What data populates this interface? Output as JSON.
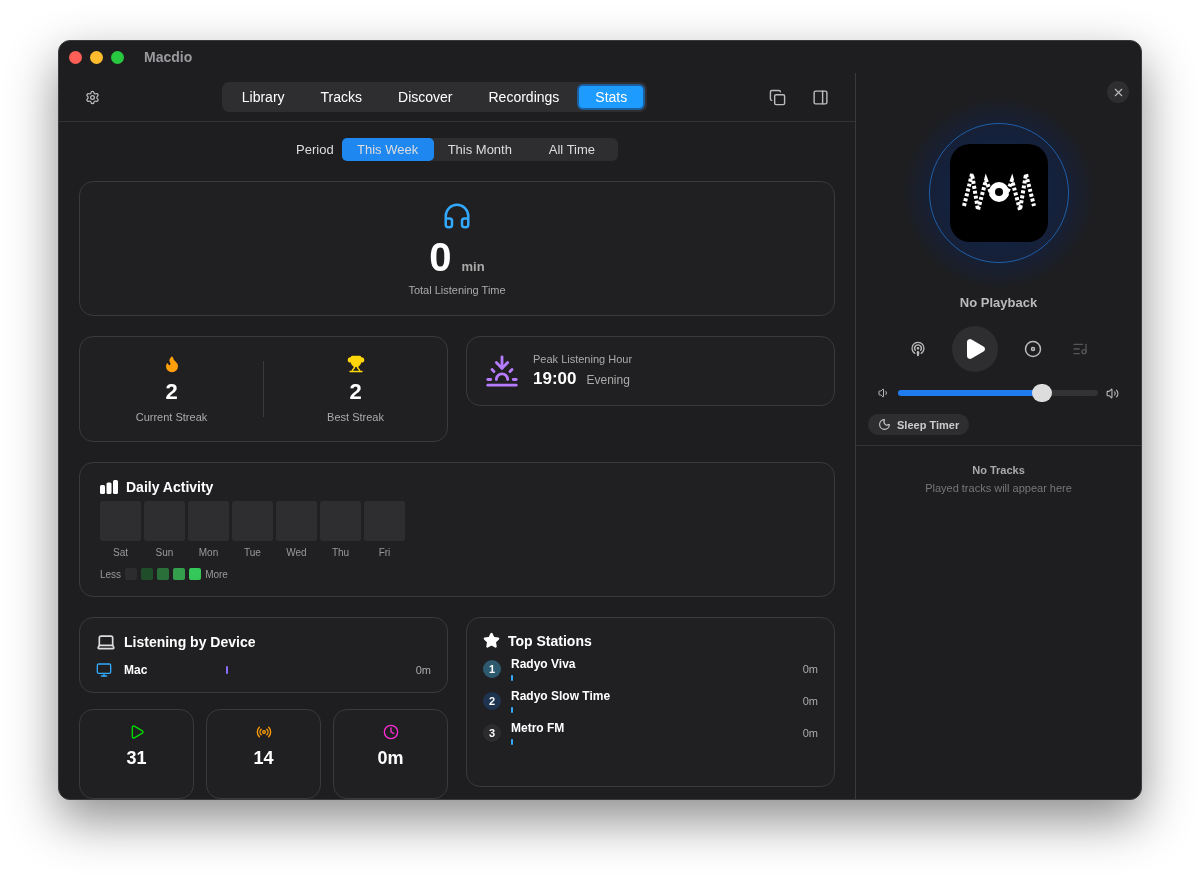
{
  "window": {
    "title": "Macdio"
  },
  "tabs": [
    {
      "label": "Library",
      "selected": false
    },
    {
      "label": "Tracks",
      "selected": false
    },
    {
      "label": "Discover",
      "selected": false
    },
    {
      "label": "Recordings",
      "selected": false
    },
    {
      "label": "Stats",
      "selected": true
    }
  ],
  "period": {
    "label": "Period",
    "options": [
      {
        "label": "This Week",
        "selected": true
      },
      {
        "label": "This Month",
        "selected": false
      },
      {
        "label": "All Time",
        "selected": false
      }
    ]
  },
  "total": {
    "value": "0",
    "unit": "min",
    "label": "Total Listening Time"
  },
  "streaks": [
    {
      "kind": "current",
      "value": "2",
      "label": "Current Streak"
    },
    {
      "kind": "best",
      "value": "2",
      "label": "Best Streak"
    }
  ],
  "peak": {
    "label": "Peak Listening Hour",
    "time": "19:00",
    "period": "Evening"
  },
  "daily_activity": {
    "title": "Daily Activity",
    "days": [
      "Sat",
      "Sun",
      "Mon",
      "Tue",
      "Wed",
      "Thu",
      "Fri"
    ],
    "legend_less": "Less",
    "legend_more": "More"
  },
  "devices": {
    "title": "Listening by Device",
    "items": [
      {
        "name": "Mac",
        "value": "0m"
      }
    ]
  },
  "counters": [
    {
      "kind": "plays",
      "value": "31"
    },
    {
      "kind": "stations",
      "value": "14"
    },
    {
      "kind": "time",
      "value": "0m"
    }
  ],
  "top_stations": {
    "title": "Top Stations",
    "items": [
      {
        "rank": "1",
        "name": "Radyo Viva",
        "value": "0m"
      },
      {
        "rank": "2",
        "name": "Radyo Slow Time",
        "value": "0m"
      },
      {
        "rank": "3",
        "name": "Metro FM",
        "value": "0m"
      }
    ]
  },
  "player": {
    "status": "No Playback",
    "volume": {
      "level": 0.72
    },
    "sleep_timer": "Sleep Timer",
    "empty_title": "No Tracks",
    "empty_hint": "Played tracks will appear here"
  }
}
